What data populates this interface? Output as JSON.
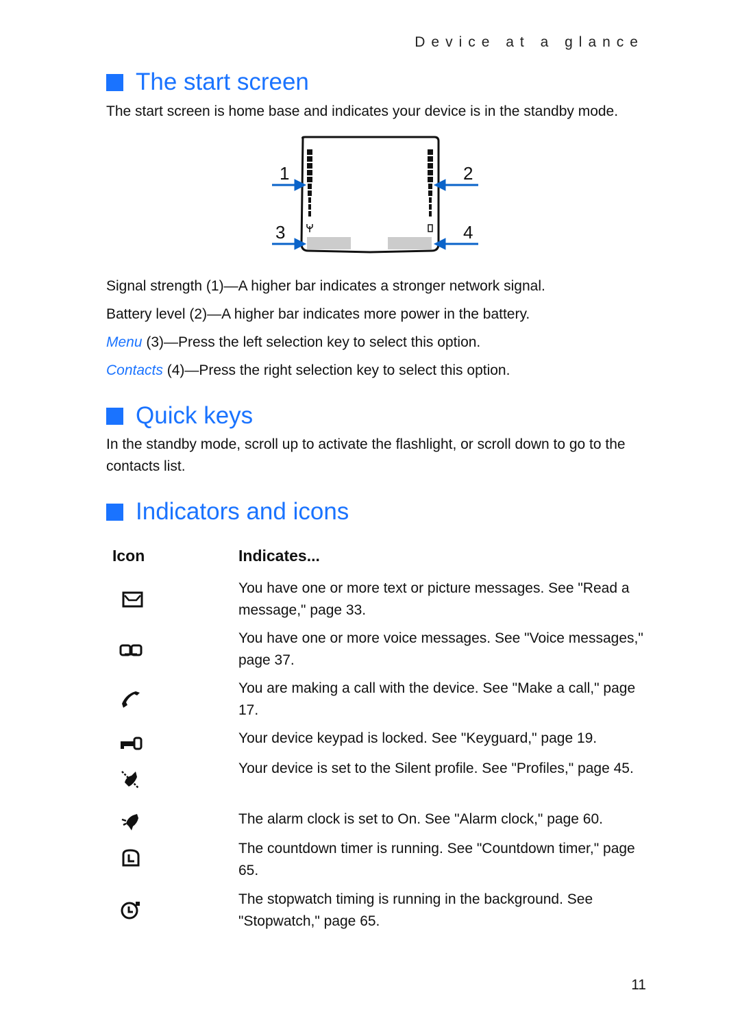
{
  "running_head": "Device at a glance",
  "sections": {
    "start_screen": {
      "title": "The start screen",
      "intro": "The start screen is home base and indicates your device is in the standby mode.",
      "callouts": [
        "1",
        "2",
        "3",
        "4"
      ],
      "items": [
        {
          "lead": "Signal strength",
          "lead_style": "plain",
          "rest": " (1)—A higher bar indicates a stronger network signal."
        },
        {
          "lead": "Battery level",
          "lead_style": "plain",
          "rest": " (2)—A higher bar indicates more power in the battery."
        },
        {
          "lead": "Menu",
          "lead_style": "blue-italic",
          "rest": " (3)—Press the left selection key to select this option."
        },
        {
          "lead": "Contacts",
          "lead_style": "blue-italic",
          "rest": " (4)—Press the right selection key to select this option."
        }
      ]
    },
    "quick_keys": {
      "title": "Quick keys",
      "body": "In the standby mode, scroll up to activate the flashlight, or scroll down to go to the contacts list."
    },
    "indicators": {
      "title": "Indicators and icons",
      "headers": {
        "icon": "Icon",
        "indicates": "Indicates..."
      },
      "rows": [
        {
          "icon": "envelope-icon",
          "text": "You have one or more text or picture messages. See \"Read a message,\" page 33."
        },
        {
          "icon": "voicemail-icon",
          "text": "You have one or more voice messages. See \"Voice messages,\" page 37."
        },
        {
          "icon": "phone-handset-icon",
          "text": "You are making a call with the device. See \"Make a call,\" page 17."
        },
        {
          "icon": "key-icon",
          "text": "Your device keypad is locked. See \"Keyguard,\" page 19."
        },
        {
          "icon": "silent-bell-icon",
          "text": "Your device is set to the Silent profile. See \"Profiles,\" page 45."
        },
        {
          "icon": "alarm-bell-icon",
          "text": "The alarm clock is set to On. See \"Alarm clock,\" page 60."
        },
        {
          "icon": "countdown-timer-icon",
          "text": "The countdown timer is running. See \"Countdown timer,\" page 65."
        },
        {
          "icon": "stopwatch-icon",
          "text": "The stopwatch timing is running in the background. See \"Stopwatch,\" page 65."
        }
      ]
    }
  },
  "colors": {
    "accent": "#1a73ff",
    "callout_arrow": "#0a63c9",
    "softkey": "#cccccc"
  },
  "page_number": "11"
}
